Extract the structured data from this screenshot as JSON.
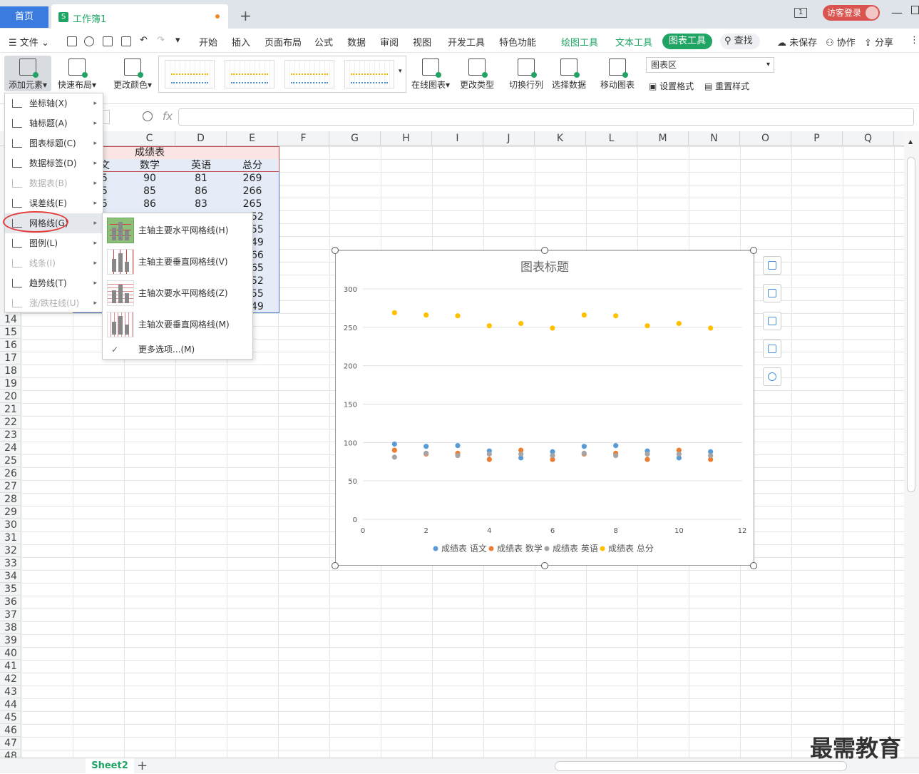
{
  "titlebar": {
    "home_tab": "首页",
    "workbook_icon": "S",
    "workbook_tab": "工作簿1",
    "new_tab": "+",
    "window_count": "1",
    "login": "访客登录"
  },
  "menubar": {
    "file": "文件",
    "items": [
      "开始",
      "插入",
      "页面布局",
      "公式",
      "数据",
      "审阅",
      "视图",
      "开发工具",
      "特色功能"
    ],
    "context_tabs": [
      "绘图工具",
      "文本工具"
    ],
    "active_context": "图表工具",
    "search": "查找",
    "right": [
      "未保存",
      "协作",
      "分享"
    ]
  },
  "ribbon": {
    "add_element": "添加元素",
    "quick_layout": "快速布局",
    "change_color": "更改颜色",
    "online_chart": "在线图表",
    "change_type": "更改类型",
    "switch_rowcol": "切换行列",
    "select_data": "选择数据",
    "move_chart": "移动图表",
    "chart_area_select": "图表区",
    "set_format": "设置格式",
    "reset_style": "重置样式"
  },
  "formula": {
    "fx": "fx"
  },
  "columns": [
    "C",
    "D",
    "E",
    "F",
    "G",
    "H",
    "I",
    "J",
    "K",
    "L",
    "M",
    "N",
    "O",
    "P",
    "Q"
  ],
  "rows": [
    "14",
    "15",
    "16",
    "17",
    "18",
    "19",
    "20",
    "21",
    "22",
    "23",
    "24",
    "25",
    "26",
    "27",
    "28",
    "29",
    "30",
    "31",
    "32",
    "33",
    "34",
    "35",
    "36",
    "37",
    "38",
    "39",
    "40",
    "41",
    "42",
    "43",
    "44",
    "45",
    "46",
    "47",
    "48"
  ],
  "table": {
    "title": "成绩表",
    "headers": [
      "文",
      "数学",
      "英语",
      "总分"
    ],
    "rows": [
      [
        "5",
        "90",
        "81",
        "269"
      ],
      [
        "5",
        "85",
        "86",
        "266"
      ],
      [
        "5",
        "86",
        "83",
        "265"
      ],
      [
        "",
        "",
        "",
        "52"
      ],
      [
        "",
        "",
        "",
        "55"
      ],
      [
        "",
        "",
        "",
        "49"
      ],
      [
        "",
        "",
        "",
        "66"
      ],
      [
        "",
        "",
        "",
        "65"
      ],
      [
        "",
        "",
        "",
        "52"
      ],
      [
        "",
        "",
        "",
        "55"
      ],
      [
        "",
        "",
        "",
        "49"
      ]
    ]
  },
  "menu": {
    "items": [
      {
        "label": "坐标轴(X)",
        "enabled": true
      },
      {
        "label": "轴标题(A)",
        "enabled": true
      },
      {
        "label": "图表标题(C)",
        "enabled": true
      },
      {
        "label": "数据标签(D)",
        "enabled": true
      },
      {
        "label": "数据表(B)",
        "enabled": false
      },
      {
        "label": "误差线(E)",
        "enabled": true
      },
      {
        "label": "网格线(G)",
        "enabled": true,
        "highlighted": true
      },
      {
        "label": "图例(L)",
        "enabled": true
      },
      {
        "label": "线条(I)",
        "enabled": false
      },
      {
        "label": "趋势线(T)",
        "enabled": true
      },
      {
        "label": "涨/跌柱线(U)",
        "enabled": false
      }
    ]
  },
  "submenu": {
    "items": [
      {
        "label": "主轴主要水平网格线(H)",
        "active": true
      },
      {
        "label": "主轴主要垂直网格线(V)",
        "active": false
      },
      {
        "label": "主轴次要水平网格线(Z)",
        "active": false
      },
      {
        "label": "主轴次要垂直网格线(M)",
        "active": false
      }
    ],
    "more": "更多选项...(M)"
  },
  "chart_data": {
    "type": "scatter",
    "title": "图表标题",
    "xlim": [
      0,
      12
    ],
    "ylim": [
      0,
      300
    ],
    "xticks": [
      0,
      2,
      4,
      6,
      8,
      10,
      12
    ],
    "yticks": [
      0,
      50,
      100,
      150,
      200,
      250,
      300
    ],
    "grid": "horizontal-major",
    "legend": "bottom",
    "x": [
      1,
      2,
      3,
      4,
      5,
      6,
      7,
      8,
      9,
      10,
      11
    ],
    "series": [
      {
        "name": "成绩表 语文",
        "color": "#5b9bd5",
        "values": [
          98,
          95,
          96,
          89,
          80,
          88,
          95,
          96,
          89,
          80,
          88
        ]
      },
      {
        "name": "成绩表 数学",
        "color": "#ed7d31",
        "values": [
          90,
          85,
          86,
          78,
          90,
          78,
          85,
          86,
          78,
          90,
          78
        ]
      },
      {
        "name": "成绩表 英语",
        "color": "#a5a5a5",
        "values": [
          81,
          86,
          83,
          85,
          85,
          83,
          86,
          83,
          85,
          85,
          83
        ]
      },
      {
        "name": "成绩表 总分",
        "color": "#ffc000",
        "values": [
          269,
          266,
          265,
          252,
          255,
          249,
          266,
          265,
          252,
          255,
          249
        ]
      }
    ]
  },
  "sheet": {
    "tab": "Sheet2",
    "add": "+"
  },
  "watermark": "最需教育"
}
